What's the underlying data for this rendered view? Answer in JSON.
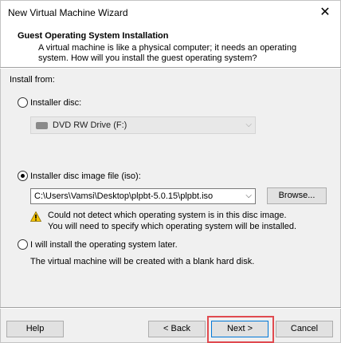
{
  "window": {
    "title": "New Virtual Machine Wizard",
    "close_glyph": "✕"
  },
  "header": {
    "title": "Guest Operating System Installation",
    "description": "A virtual machine is like a physical computer; it needs an operating system. How will you install the guest operating system?"
  },
  "install_from": {
    "label": "Install from:",
    "options": [
      {
        "label": "Installer disc:",
        "selected": false
      },
      {
        "label": "Installer disc image file (iso):",
        "selected": true
      },
      {
        "label": "I will install the operating system later.",
        "selected": false
      }
    ],
    "disc_drive": {
      "value": "DVD RW Drive (F:)",
      "enabled": false
    },
    "iso_path": {
      "value": "C:\\Users\\Vamsi\\Desktop\\plpbt-5.0.15\\plpbt.iso"
    },
    "browse_label": "Browse...",
    "warning_line1": "Could not detect which operating system is in this disc image.",
    "warning_line2": "You will need to specify which operating system will be installed.",
    "later_note": "The virtual machine will be created with a blank hard disk."
  },
  "footer": {
    "help_label": "Help",
    "back_label": "< Back",
    "next_label": "Next >",
    "cancel_label": "Cancel"
  },
  "colors": {
    "accent_focus": "#0078d7",
    "highlight": "#e04a4f",
    "warning": "#f5c400"
  }
}
